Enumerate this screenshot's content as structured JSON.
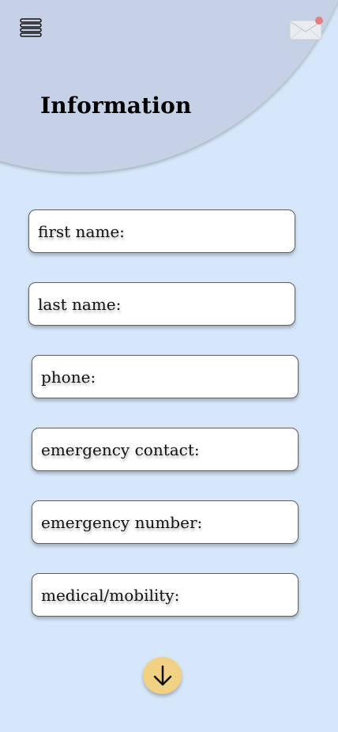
{
  "header": {
    "title": "Information",
    "menu_icon": "menu-icon",
    "mail_icon": "mail-icon",
    "has_notification": true
  },
  "form": {
    "fields": [
      {
        "label": "first name:",
        "value": ""
      },
      {
        "label": "last name:",
        "value": ""
      },
      {
        "label": "phone:",
        "value": ""
      },
      {
        "label": "emergency contact:",
        "value": ""
      },
      {
        "label": "emergency number:",
        "value": ""
      },
      {
        "label": "medical/mobility:",
        "value": ""
      }
    ]
  },
  "footer": {
    "next_icon": "arrow-down-icon"
  },
  "colors": {
    "background": "#d6e7f9",
    "header": "#c7d1e6",
    "field_background": "#ffffff",
    "button": "#f1d183",
    "notification_dot": "#e07f7f"
  }
}
